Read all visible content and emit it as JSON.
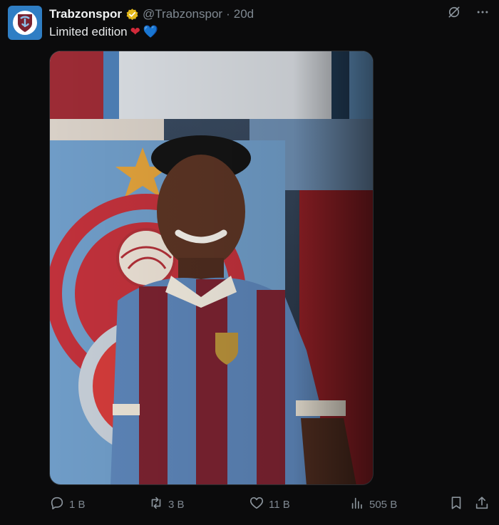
{
  "account": {
    "display_name": "Trabzonspor",
    "handle": "@Trabzonspor",
    "separator": "·",
    "time": "20d"
  },
  "post": {
    "text": "Limited edition",
    "emoji_1": "❤",
    "emoji_2": "💙"
  },
  "actions": {
    "replies": "1 B",
    "reposts": "3 B",
    "likes": "11 B",
    "views": "505 B"
  },
  "icons": {
    "header": [
      "grok-icon",
      "more-icon"
    ],
    "actions": [
      "reply-icon",
      "repost-icon",
      "like-icon",
      "views-icon",
      "bookmark-icon",
      "share-icon"
    ]
  },
  "colors": {
    "background": "#0b0b0c",
    "muted_text": "#7f8891",
    "verified_gold": "#e2b719",
    "club_blue": "#5b8ec2",
    "club_claret": "#7a2230"
  }
}
